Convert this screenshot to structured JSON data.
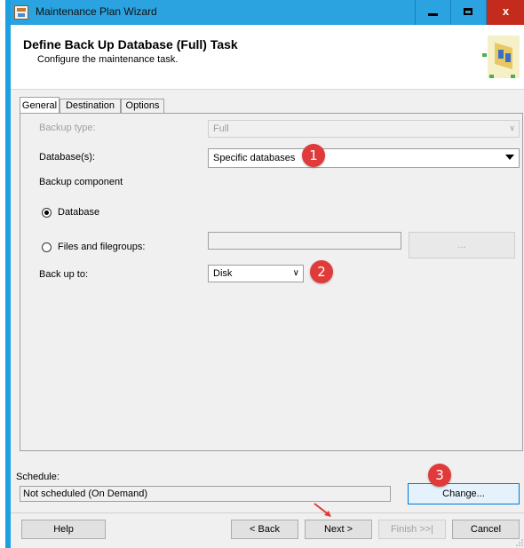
{
  "window": {
    "title": "Maintenance Plan Wizard",
    "controls": {
      "minimize": "",
      "maximize": "",
      "close": "x"
    }
  },
  "header": {
    "title": "Define Back Up Database (Full) Task",
    "subtitle": "Configure the maintenance task."
  },
  "tabs": [
    {
      "label": "General",
      "active": true
    },
    {
      "label": "Destination",
      "active": false
    },
    {
      "label": "Options",
      "active": false
    }
  ],
  "form": {
    "backup_type_label": "Backup type:",
    "backup_type_value": "Full",
    "databases_label": "Database(s):",
    "databases_value": "Specific databases",
    "backup_component_label": "Backup component",
    "radio_database_label": "Database",
    "radio_database_selected": true,
    "radio_files_label": "Files and filegroups:",
    "radio_files_selected": false,
    "files_value": "",
    "ellipsis_label": "...",
    "back_up_to_label": "Back up to:",
    "back_up_to_value": "Disk"
  },
  "annotations": [
    "1",
    "2",
    "3"
  ],
  "schedule": {
    "label": "Schedule:",
    "value": "Not scheduled (On Demand)",
    "change_label": "Change..."
  },
  "buttons": {
    "help": "Help",
    "back": "< Back",
    "next": "Next >",
    "finish": "Finish >>|",
    "cancel": "Cancel"
  },
  "colors": {
    "titlebar": "#2aa3e0",
    "close": "#c42b1c",
    "badge": "#e03a3a"
  }
}
